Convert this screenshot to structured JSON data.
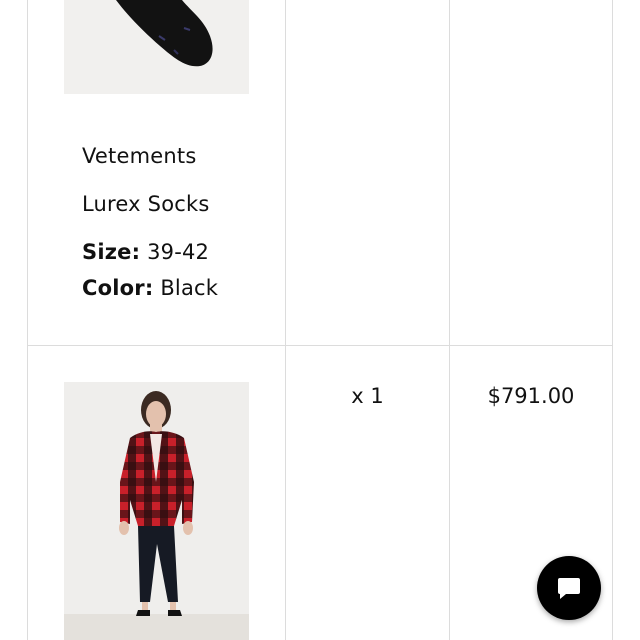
{
  "order_items": [
    {
      "brand": "Vetements",
      "name": "Lurex Socks",
      "size_label": "Size:",
      "size": "39-42",
      "color_label": "Color:",
      "color": "Black",
      "image_icon": "sock-image"
    },
    {
      "quantity": "x 1",
      "price": "$791.00",
      "image_icon": "plaid-jacket-image"
    }
  ],
  "chat": {
    "icon": "chat-bubble-icon",
    "color": "#000000"
  },
  "colors": {
    "border": "#dcdcdc",
    "image_bg": "#f1f0ee",
    "plaid_red": "#c8202a"
  }
}
